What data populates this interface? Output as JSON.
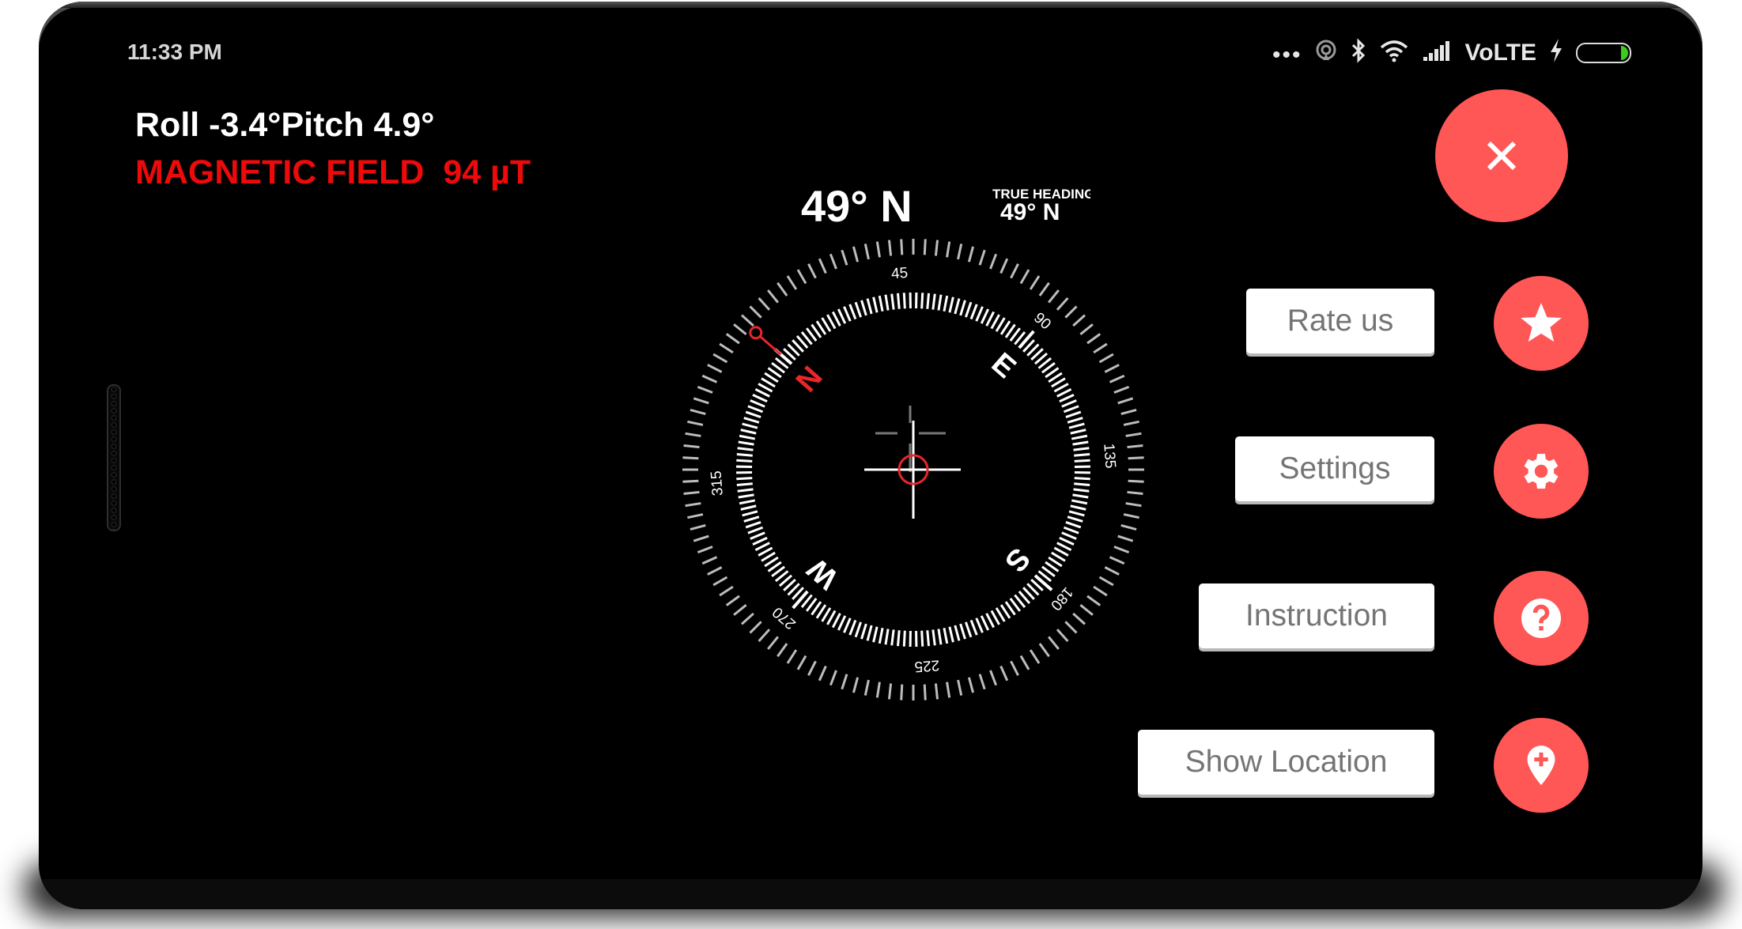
{
  "status_bar": {
    "time": "11:33 PM",
    "overflow_dots": "•••",
    "network_label": "VoLTE",
    "battery_level_percent": 15,
    "icons": [
      "hotspot-icon",
      "bluetooth-icon",
      "wifi-icon",
      "signal-icon",
      "charging-icon",
      "battery-icon"
    ]
  },
  "readouts": {
    "roll_pitch": "Roll -3.4°Pitch 4.9°",
    "magnetic_field": "MAGNETIC FIELD  94 µT"
  },
  "compass": {
    "heading_text": "49° N",
    "true_heading_label": "TRUE HEADING",
    "true_heading_value": "49° N",
    "heading_degrees": 49,
    "cardinals": [
      {
        "label": "N",
        "angle": 0,
        "color": "#e8262b"
      },
      {
        "label": "E",
        "angle": 90,
        "color": "#ffffff"
      },
      {
        "label": "S",
        "angle": 180,
        "color": "#ffffff"
      },
      {
        "label": "W",
        "angle": 270,
        "color": "#ffffff"
      }
    ],
    "degree_labels": [
      {
        "label": "45",
        "angle": 45
      },
      {
        "label": "90",
        "angle": 90
      },
      {
        "label": "135",
        "angle": 135
      },
      {
        "label": "180",
        "angle": 180
      },
      {
        "label": "225",
        "angle": 225
      },
      {
        "label": "270",
        "angle": 270
      },
      {
        "label": "315",
        "angle": 315
      }
    ],
    "north_marker_color": "#e8262b",
    "center_ring_color": "#e8262b"
  },
  "menu": {
    "close_label": "×",
    "items": [
      {
        "label": "Rate us",
        "icon": "star-icon"
      },
      {
        "label": "Settings",
        "icon": "gear-icon"
      },
      {
        "label": "Instruction",
        "icon": "help-icon"
      },
      {
        "label": "Show Location",
        "icon": "add-location-icon"
      }
    ]
  },
  "colors": {
    "accent": "#ff5656",
    "magnetic_text": "#ee0a0a",
    "background": "#000000",
    "battery_fill": "#3ccc1a"
  }
}
